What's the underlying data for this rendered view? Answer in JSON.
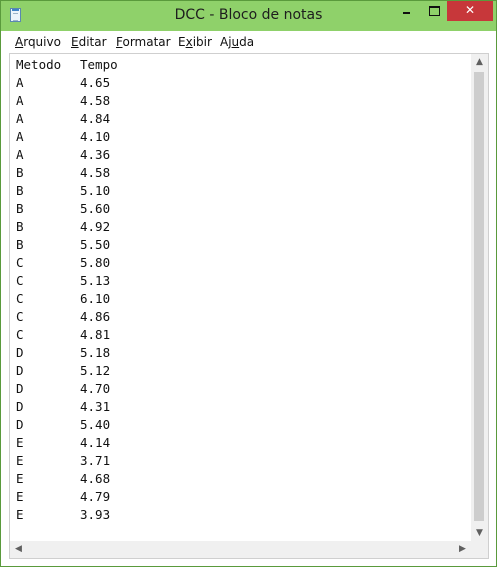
{
  "window": {
    "title": "DCC - Bloco de notas",
    "icon": "notepad-icon",
    "controls": {
      "minimize": "minimize-icon",
      "maximize": "maximize-icon",
      "close": "close-icon"
    }
  },
  "menubar": {
    "items": [
      {
        "label": "Arquivo",
        "mnemonic": "A",
        "rest": "rquivo"
      },
      {
        "label": "Editar",
        "mnemonic": "E",
        "rest": "ditar"
      },
      {
        "label": "Formatar",
        "mnemonic": "F",
        "rest": "ormatar"
      },
      {
        "label": "Exibir",
        "mnemonic": "x",
        "pre": "E",
        "rest": "ibir"
      },
      {
        "label": "Ajuda",
        "mnemonic": "u",
        "pre": "Aj",
        "rest": "da"
      }
    ]
  },
  "document": {
    "header": {
      "col1": "Metodo",
      "col2": "Tempo"
    },
    "rows": [
      [
        "A",
        "4.65"
      ],
      [
        "A",
        "4.58"
      ],
      [
        "A",
        "4.84"
      ],
      [
        "A",
        "4.10"
      ],
      [
        "A",
        "4.36"
      ],
      [
        "B",
        "4.58"
      ],
      [
        "B",
        "5.10"
      ],
      [
        "B",
        "5.60"
      ],
      [
        "B",
        "4.92"
      ],
      [
        "B",
        "5.50"
      ],
      [
        "C",
        "5.80"
      ],
      [
        "C",
        "5.13"
      ],
      [
        "C",
        "6.10"
      ],
      [
        "C",
        "4.86"
      ],
      [
        "C",
        "4.81"
      ],
      [
        "D",
        "5.18"
      ],
      [
        "D",
        "5.12"
      ],
      [
        "D",
        "4.70"
      ],
      [
        "D",
        "4.31"
      ],
      [
        "D",
        "5.40"
      ],
      [
        "E",
        "4.14"
      ],
      [
        "E",
        "3.71"
      ],
      [
        "E",
        "4.68"
      ],
      [
        "E",
        "4.79"
      ],
      [
        "E",
        "3.93"
      ]
    ]
  },
  "scrollbars": {
    "up": "▲",
    "down": "▼",
    "left": "◀",
    "right": "▶"
  }
}
